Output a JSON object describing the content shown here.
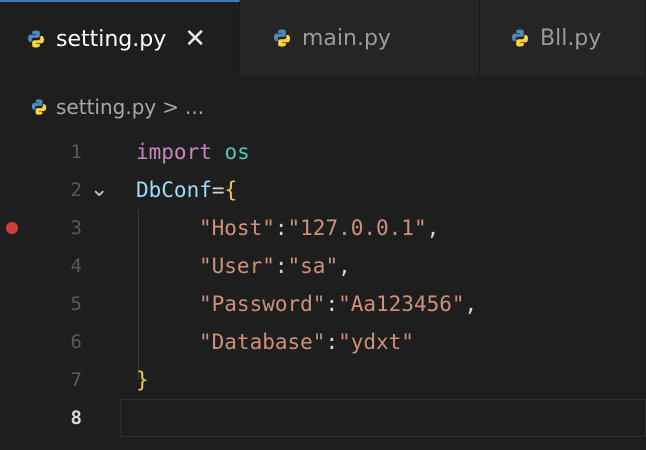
{
  "tabs": [
    {
      "label": "setting.py",
      "active": true,
      "close": "✕"
    },
    {
      "label": "main.py",
      "active": false
    },
    {
      "label": "Bll.py",
      "active": false
    }
  ],
  "breadcrumb": {
    "file": "setting.py",
    "sep": ">",
    "rest": "..."
  },
  "editor": {
    "line_numbers": [
      "1",
      "2",
      "3",
      "4",
      "5",
      "6",
      "7",
      "8"
    ],
    "code": {
      "l1": {
        "kw": "import",
        "mod": "os"
      },
      "l2": {
        "var": "DbConf",
        "op": "=",
        "brace": "{"
      },
      "l3": {
        "key": "\"Host\"",
        "colon": ":",
        "val": "\"127.0.0.1\"",
        "comma": ","
      },
      "l4": {
        "key": "\"User\"",
        "colon": ":",
        "val": "\"sa\"",
        "comma": ","
      },
      "l5": {
        "key": "\"Password\"",
        "colon": ":",
        "val": "\"Aa123456\"",
        "comma": ","
      },
      "l6": {
        "key": "\"Database\"",
        "colon": ":",
        "val": "\"ydxt\""
      },
      "l7": {
        "brace": "}"
      }
    },
    "fold_glyph": "⌄",
    "breakpoint_line": "3",
    "current_line": "8"
  },
  "colors": {
    "accent": "#3b78c9",
    "breakpoint": "#d43b3b",
    "keyword": "#c586c0",
    "string": "#ce9178"
  },
  "icons": {
    "file": "python-file-icon",
    "close": "close-icon",
    "fold": "chevron-down-icon"
  }
}
